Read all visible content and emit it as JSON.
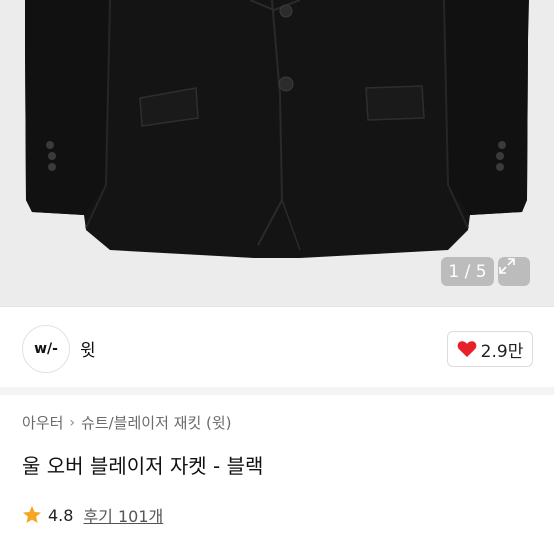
{
  "gallery": {
    "counter": "1 / 5",
    "expand_icon": "expand-icon",
    "background": "#ececec",
    "jacket_color": "#141414"
  },
  "shop": {
    "logo_text": "w/-",
    "name": "윗",
    "likes": "2.9만",
    "heart_color": "#e8202a"
  },
  "product": {
    "breadcrumb": [
      "아우터",
      "슈트/블레이저 재킷 (윗)"
    ],
    "title": "울 오버 블레이저 자켓 - 블랙",
    "rating": "4.8",
    "reviews": "후기 101개",
    "star_color": "#f5a623"
  }
}
